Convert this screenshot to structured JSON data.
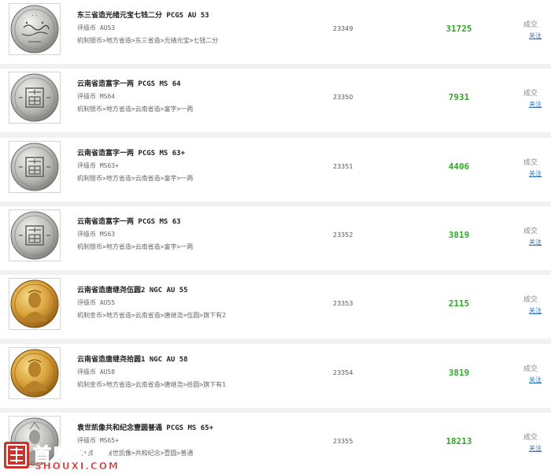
{
  "listing": {
    "items": [
      {
        "title": "东三省造光绪元宝七钱二分 PCGS AU 53",
        "grade": "评级币 AU53",
        "path": "机制银币>地方省造>东三省造>光绪元宝>七钱二分",
        "lot": "23349",
        "price": "31725",
        "status": "成交",
        "follow": "关注",
        "coin": "silver-dragon"
      },
      {
        "title": "云南省造富字一两 PCGS MS 64",
        "grade": "评级币 MS64",
        "path": "机制银币>地方省造>云南省造>富字>一两",
        "lot": "23350",
        "price": "7931",
        "status": "成交",
        "follow": "关注",
        "coin": "silver-fu"
      },
      {
        "title": "云南省造富字一两 PCGS MS 63+",
        "grade": "评级币 MS63+",
        "path": "机制银币>地方省造>云南省造>富字>一两",
        "lot": "23351",
        "price": "4406",
        "status": "成交",
        "follow": "关注",
        "coin": "silver-fu"
      },
      {
        "title": "云南省造富字一两 PCGS MS 63",
        "grade": "评级币 MS63",
        "path": "机制银币>地方省造>云南省造>富字>一两",
        "lot": "23352",
        "price": "3819",
        "status": "成交",
        "follow": "关注",
        "coin": "silver-fu"
      },
      {
        "title": "云南省造唐继尧伍圆2 NGC AU 55",
        "grade": "评级币 AU55",
        "path": "机制金币>地方省造>云南省造>唐继尧>伍圆>旗下有2",
        "lot": "23353",
        "price": "2115",
        "status": "成交",
        "follow": "关注",
        "coin": "gold-portrait"
      },
      {
        "title": "云南省造唐继尧拾圆1 NGC AU 58",
        "grade": "评级币 AU58",
        "path": "机制金币>地方省造>云南省造>唐继尧>拾圆>旗下有1",
        "lot": "23354",
        "price": "3819",
        "status": "成交",
        "follow": "关注",
        "coin": "gold-portrait"
      },
      {
        "title": "袁世凯像共和纪念壹圆普通 PCGS MS 65+",
        "grade": "评级币 MS65+",
        "path": "机制银币>袁世凯像>共和纪念>壹圆>普通",
        "lot": "23355",
        "price": "18213",
        "status": "成交",
        "follow": "关注",
        "coin": "silver-yuan"
      }
    ]
  },
  "watermark": {
    "chinese": "首席收藏",
    "english": "SHOUXI.COM"
  },
  "colors": {
    "price": "#33a62a",
    "link": "#2a6fc1",
    "row_separator": "#f1f1f1",
    "brand_red": "#c9342c"
  }
}
